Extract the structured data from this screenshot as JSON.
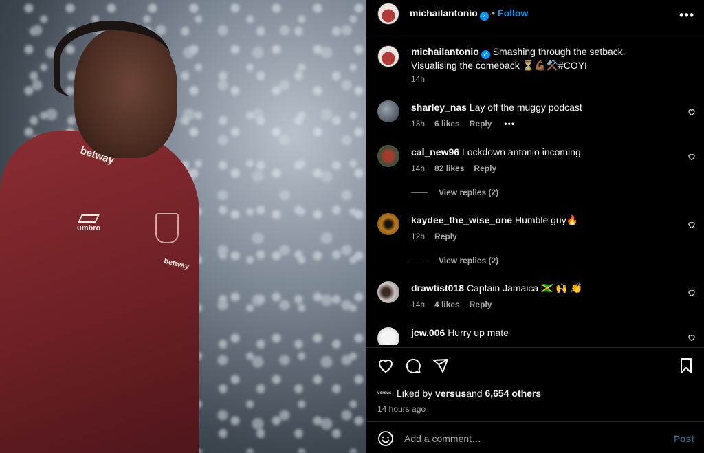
{
  "photo": {
    "jacket_sponsor": "betway",
    "jacket_maker": "umbro",
    "jacket_sponsor_sleeve": "betway"
  },
  "header": {
    "username": "michailantonio",
    "verified_glyph": "✓",
    "follow_label": "Follow",
    "more_label": "•••"
  },
  "caption": {
    "username": "michailantonio",
    "text": "Smashing through the setback. Visualising the comeback ⏳💪🏾⚒️#COYI",
    "time": "14h"
  },
  "comments": [
    {
      "username": "sharley_nas",
      "text": "Lay off the muggy podcast",
      "time": "13h",
      "likes": "6 likes",
      "reply": "Reply",
      "more": "•••"
    },
    {
      "username": "cal_new96",
      "text": "Lockdown antonio incoming",
      "time": "14h",
      "likes": "82 likes",
      "reply": "Reply",
      "view_replies": "View replies (2)"
    },
    {
      "username": "kaydee_the_wise_one",
      "text": "Humble guy🔥",
      "time": "12h",
      "reply": "Reply",
      "view_replies": "View replies (2)"
    },
    {
      "username": "drawtist018",
      "text": "Captain Jamaica 🇯🇲 🙌 👏",
      "time": "14h",
      "likes": "4 likes",
      "reply": "Reply"
    },
    {
      "username": "jcw.006",
      "text": "Hurry up mate"
    }
  ],
  "likes": {
    "avatar_text": "versus",
    "prefix": "Liked by ",
    "user": "versus",
    "middle": " and ",
    "others": "6,654 others"
  },
  "time_ago": "14 hours ago",
  "comment_input": {
    "placeholder": "Add a comment…",
    "post_label": "Post"
  },
  "colors": {
    "accent": "#0095f6",
    "background": "#000000",
    "muted_text": "#a8a8a8"
  }
}
